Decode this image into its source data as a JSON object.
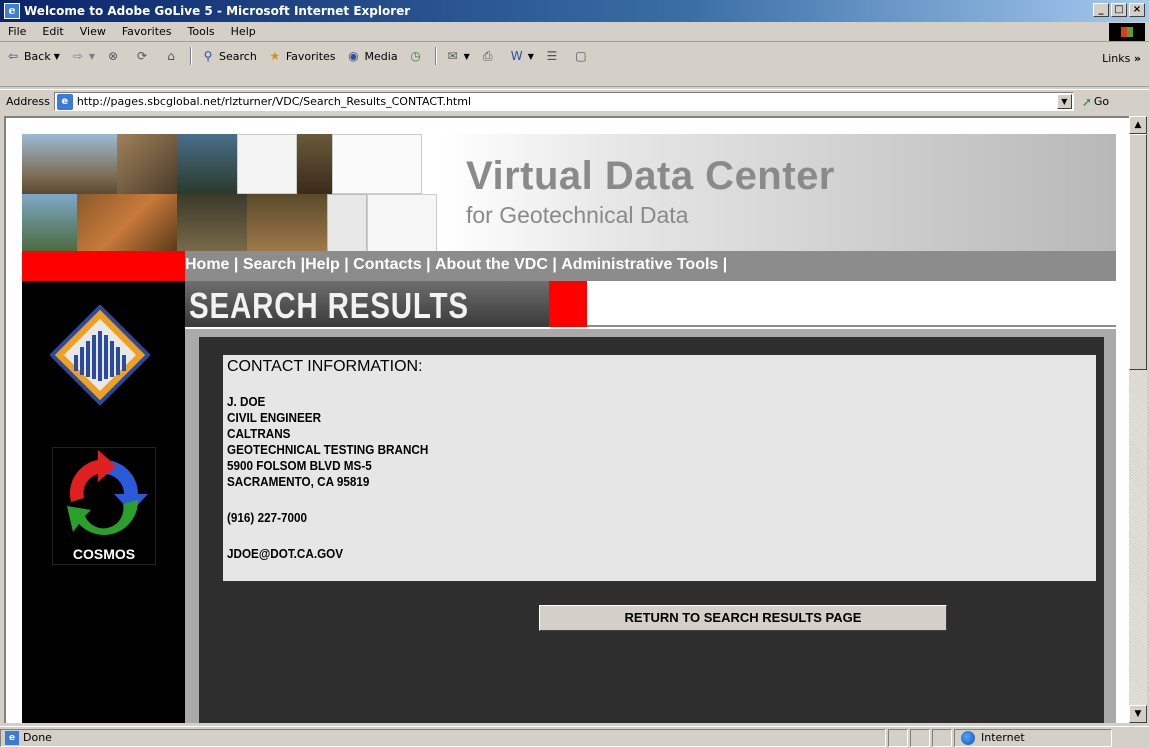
{
  "window": {
    "title": "Welcome to Adobe GoLive 5 - Microsoft Internet Explorer",
    "controls": [
      "_",
      "□",
      "×"
    ]
  },
  "menu": [
    "File",
    "Edit",
    "View",
    "Favorites",
    "Tools",
    "Help"
  ],
  "toolbar": {
    "back": "Back",
    "search": "Search",
    "favorites": "Favorites",
    "media": "Media",
    "links": "Links"
  },
  "address": {
    "label": "Address",
    "url": "http://pages.sbcglobal.net/rlzturner/VDC/Search_Results_CONTACT.html",
    "go": "Go"
  },
  "page": {
    "banner_title": "Virtual Data Center",
    "banner_subtitle": "for Geotechnical Data",
    "nav": [
      "Home",
      "Search",
      "Help",
      "Contacts",
      "About the VDC",
      "Administrative Tools"
    ],
    "section_title": "SEARCH RESULTS",
    "cosmos_label": "COSMOS",
    "contact_heading": "CONTACT INFORMATION:",
    "contact_lines": [
      "J. DOE",
      "CIVIL ENGINEER",
      "CALTRANS",
      "GEOTECHNICAL TESTING BRANCH",
      "5900 FOLSOM BLVD MS-5",
      "SACRAMENTO, CA 95819"
    ],
    "phone": "(916) 227-7000",
    "email": "JDOE@DOT.CA.GOV",
    "return_button": "RETURN TO SEARCH RESULTS PAGE"
  },
  "status": {
    "text": "Done",
    "zone": "Internet"
  }
}
